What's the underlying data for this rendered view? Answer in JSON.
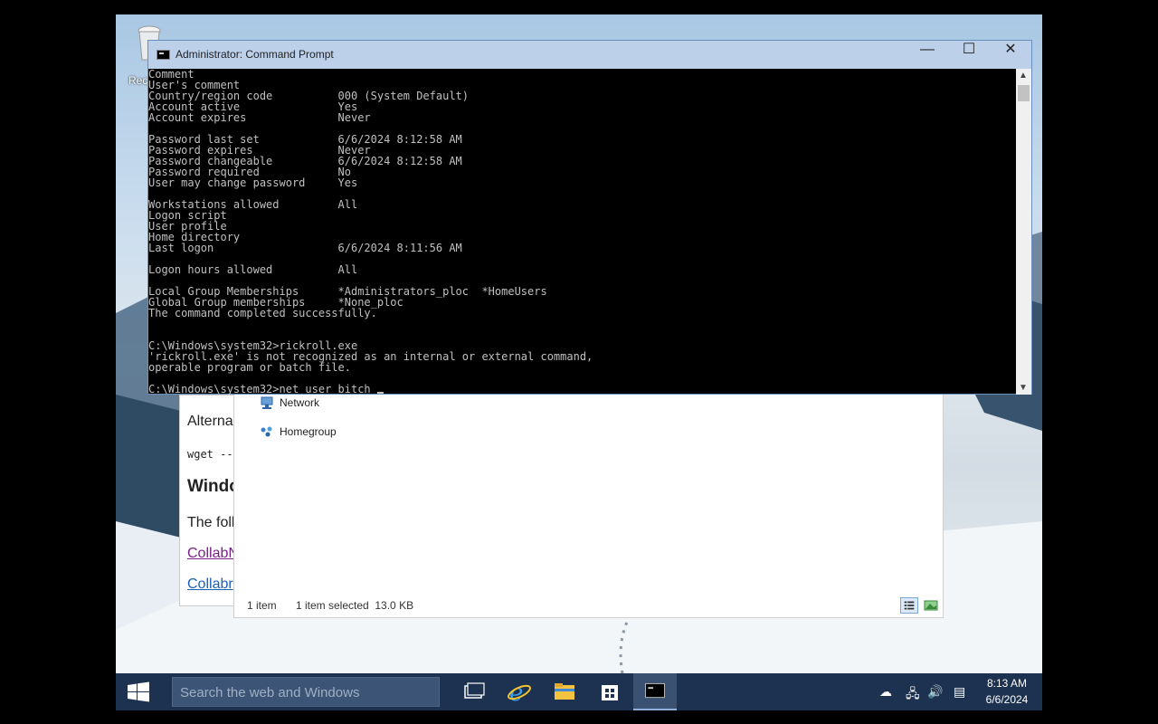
{
  "desktop": {
    "recycle_bin_label": "Recy"
  },
  "browser": {
    "line1": "Alterna",
    "line2": "wget --",
    "heading": "Windo",
    "line3": "The foll",
    "link1": "CollabN",
    "link2": "Collabr"
  },
  "explorer": {
    "nav_items": [
      "Network",
      "Homegroup"
    ],
    "status_items": "1 item",
    "status_selected": "1 item selected  13.0 KB"
  },
  "cmd": {
    "title": "Administrator: Command Prompt",
    "minimize": "—",
    "maximize": "☐",
    "close": "✕",
    "lines": [
      "Comment",
      "User's comment",
      "Country/region code          000 (System Default)",
      "Account active               Yes",
      "Account expires              Never",
      "",
      "Password last set            6/6/2024 8:12:58 AM",
      "Password expires             Never",
      "Password changeable          6/6/2024 8:12:58 AM",
      "Password required            No",
      "User may change password     Yes",
      "",
      "Workstations allowed         All",
      "Logon script",
      "User profile",
      "Home directory",
      "Last logon                   6/6/2024 8:11:56 AM",
      "",
      "Logon hours allowed          All",
      "",
      "Local Group Memberships      *Administrators_ploc  *HomeUsers",
      "Global Group memberships     *None_ploc",
      "The command completed successfully.",
      "",
      "",
      "C:\\Windows\\system32>rickroll.exe",
      "'rickroll.exe' is not recognized as an internal or external command,",
      "operable program or batch file.",
      "",
      "C:\\Windows\\system32>net user bitch "
    ]
  },
  "taskbar": {
    "search_placeholder": "Search the web and Windows",
    "time": "8:13 AM",
    "date": "6/6/2024"
  }
}
